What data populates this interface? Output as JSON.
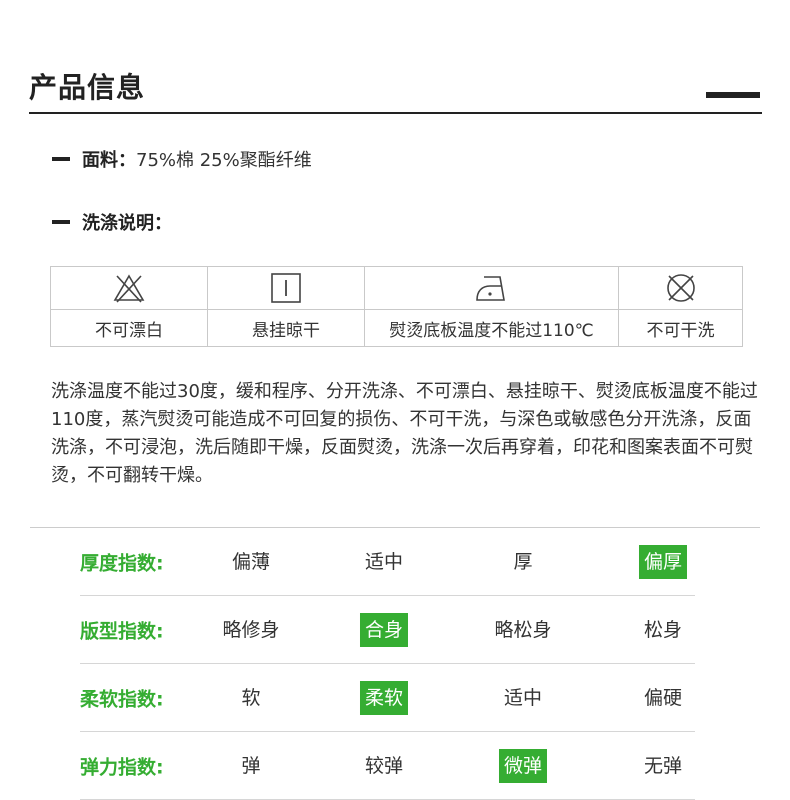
{
  "section": {
    "title": "产品信息"
  },
  "fabric": {
    "label": "面料：",
    "value": "75%棉 25%聚酯纤维"
  },
  "washing": {
    "label": "洗涤说明："
  },
  "care_table": {
    "items": [
      {
        "icon": "no-bleach-icon",
        "label": "不可漂白"
      },
      {
        "icon": "hang-dry-icon",
        "label": "悬挂晾干"
      },
      {
        "icon": "iron-icon",
        "label": "熨烫底板温度不能过110℃"
      },
      {
        "icon": "no-dry-clean-icon",
        "label": "不可干洗"
      }
    ]
  },
  "description": "洗涤温度不能过30度，缓和程序、分开洗涤、不可漂白、悬挂晾干、熨烫底板温度不能过110度，蒸汽熨烫可能造成不可回复的损伤、不可干洗，与深色或敏感色分开洗涤，反面洗涤，不可浸泡，洗后随即干燥，反面熨烫，洗涤一次后再穿着，印花和图案表面不可熨烫，不可翻转干燥。",
  "indices": [
    {
      "label": "厚度指数:",
      "options": [
        "偏薄",
        "适中",
        "厚",
        "偏厚"
      ],
      "selected": "偏厚"
    },
    {
      "label": "版型指数:",
      "options": [
        "略修身",
        "合身",
        "略松身",
        "松身"
      ],
      "selected": "合身"
    },
    {
      "label": "柔软指数:",
      "options": [
        "软",
        "柔软",
        "适中",
        "偏硬"
      ],
      "selected": "柔软"
    },
    {
      "label": "弹力指数:",
      "options": [
        "弹",
        "较弹",
        "微弹",
        "无弹"
      ],
      "selected": "微弹"
    }
  ],
  "colors": {
    "accent_green": "#35ad32",
    "text": "#333333",
    "rule": "#222222"
  }
}
